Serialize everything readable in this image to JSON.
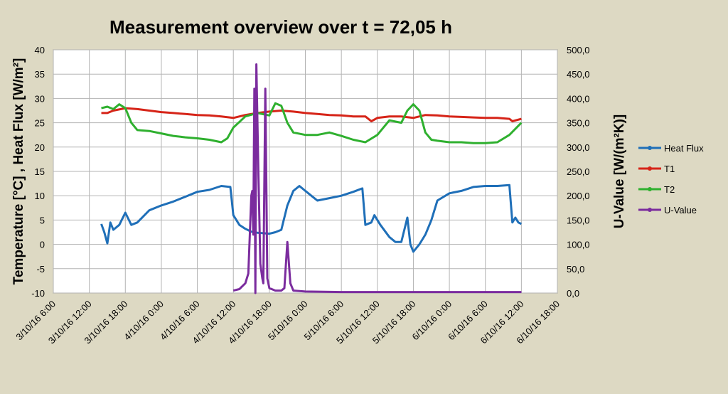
{
  "chart_data": {
    "type": "line",
    "title": "Measurement overview over t = 72,05 h",
    "ylabel": "Temperature [°C] , Heat Flux [W/m²]",
    "y2label": "U-Value [W/(m²K)]",
    "xlabel": "",
    "ylim": [
      -10,
      40
    ],
    "y2lim": [
      0,
      500
    ],
    "xlim": [
      "2016-10-03T06:00",
      "2016-10-06T18:00"
    ],
    "x_ticks": [
      "3/10/16 6:00",
      "3/10/16 12:00",
      "3/10/16 18:00",
      "4/10/16 0:00",
      "4/10/16 6:00",
      "4/10/16 12:00",
      "4/10/16 18:00",
      "5/10/16 0:00",
      "5/10/16 6:00",
      "5/10/16 12:00",
      "5/10/16 18:00",
      "6/10/16 0:00",
      "6/10/16 6:00",
      "6/10/16 12:00",
      "6/10/16 18:00"
    ],
    "y_ticks": [
      "40",
      "35",
      "30",
      "25",
      "20",
      "15",
      "10",
      "5",
      "0",
      "-5",
      "-10"
    ],
    "y2_ticks": [
      "500,0",
      "450,0",
      "400,0",
      "350,0",
      "300,0",
      "250,0",
      "200,0",
      "150,0",
      "100,0",
      "50,0",
      "0,0"
    ],
    "grid": true,
    "legend_position": "right",
    "series": [
      {
        "name": "Heat Flux",
        "axis": "left",
        "color": "#1f6fb8",
        "points": [
          [
            "2016-10-03T14:00",
            4.2
          ],
          [
            "2016-10-03T14:30",
            2.5
          ],
          [
            "2016-10-03T15:00",
            0.2
          ],
          [
            "2016-10-03T15:30",
            4.5
          ],
          [
            "2016-10-03T16:00",
            3.0
          ],
          [
            "2016-10-03T17:00",
            4.0
          ],
          [
            "2016-10-03T18:00",
            6.5
          ],
          [
            "2016-10-03T19:00",
            4.0
          ],
          [
            "2016-10-03T20:00",
            4.5
          ],
          [
            "2016-10-03T22:00",
            7.0
          ],
          [
            "2016-10-04T00:00",
            8.0
          ],
          [
            "2016-10-04T02:00",
            8.8
          ],
          [
            "2016-10-04T04:00",
            9.8
          ],
          [
            "2016-10-04T06:00",
            10.8
          ],
          [
            "2016-10-04T08:00",
            11.2
          ],
          [
            "2016-10-04T10:00",
            12.0
          ],
          [
            "2016-10-04T11:30",
            11.8
          ],
          [
            "2016-10-04T12:00",
            6.0
          ],
          [
            "2016-10-04T13:00",
            4.0
          ],
          [
            "2016-10-04T14:00",
            3.2
          ],
          [
            "2016-10-04T15:00",
            2.6
          ],
          [
            "2016-10-04T16:00",
            2.4
          ],
          [
            "2016-10-04T17:00",
            2.3
          ],
          [
            "2016-10-04T18:00",
            2.2
          ],
          [
            "2016-10-04T19:00",
            2.5
          ],
          [
            "2016-10-04T20:00",
            3.0
          ],
          [
            "2016-10-04T21:00",
            8.0
          ],
          [
            "2016-10-04T22:00",
            11.0
          ],
          [
            "2016-10-04T23:00",
            12.0
          ],
          [
            "2016-10-05T00:00",
            11.0
          ],
          [
            "2016-10-05T01:00",
            10.0
          ],
          [
            "2016-10-05T02:00",
            9.0
          ],
          [
            "2016-10-05T04:00",
            9.5
          ],
          [
            "2016-10-05T06:00",
            10.0
          ],
          [
            "2016-10-05T08:00",
            10.8
          ],
          [
            "2016-10-05T09:30",
            11.5
          ],
          [
            "2016-10-05T10:00",
            4.0
          ],
          [
            "2016-10-05T11:00",
            4.5
          ],
          [
            "2016-10-05T11:30",
            6.0
          ],
          [
            "2016-10-05T12:30",
            4.0
          ],
          [
            "2016-10-05T14:00",
            1.5
          ],
          [
            "2016-10-05T15:00",
            0.5
          ],
          [
            "2016-10-05T16:00",
            0.5
          ],
          [
            "2016-10-05T17:00",
            5.5
          ],
          [
            "2016-10-05T17:30",
            0.0
          ],
          [
            "2016-10-05T18:00",
            -1.5
          ],
          [
            "2016-10-05T19:00",
            0.0
          ],
          [
            "2016-10-05T20:00",
            2.0
          ],
          [
            "2016-10-05T21:00",
            5.0
          ],
          [
            "2016-10-05T22:00",
            9.0
          ],
          [
            "2016-10-06T00:00",
            10.5
          ],
          [
            "2016-10-06T02:00",
            11.0
          ],
          [
            "2016-10-06T04:00",
            11.8
          ],
          [
            "2016-10-06T06:00",
            12.0
          ],
          [
            "2016-10-06T08:00",
            12.0
          ],
          [
            "2016-10-06T10:00",
            12.2
          ],
          [
            "2016-10-06T10:30",
            4.5
          ],
          [
            "2016-10-06T11:00",
            5.5
          ],
          [
            "2016-10-06T11:30",
            4.5
          ],
          [
            "2016-10-06T12:00",
            4.2
          ]
        ]
      },
      {
        "name": "T1",
        "axis": "left",
        "color": "#d62418",
        "points": [
          [
            "2016-10-03T14:00",
            27.0
          ],
          [
            "2016-10-03T15:00",
            27.0
          ],
          [
            "2016-10-03T16:00",
            27.5
          ],
          [
            "2016-10-03T18:00",
            28.0
          ],
          [
            "2016-10-03T20:00",
            27.8
          ],
          [
            "2016-10-03T22:00",
            27.5
          ],
          [
            "2016-10-04T00:00",
            27.2
          ],
          [
            "2016-10-04T02:00",
            27.0
          ],
          [
            "2016-10-04T04:00",
            26.8
          ],
          [
            "2016-10-04T06:00",
            26.6
          ],
          [
            "2016-10-04T08:00",
            26.5
          ],
          [
            "2016-10-04T10:00",
            26.3
          ],
          [
            "2016-10-04T12:00",
            26.0
          ],
          [
            "2016-10-04T14:00",
            26.6
          ],
          [
            "2016-10-04T16:00",
            27.0
          ],
          [
            "2016-10-04T18:00",
            27.3
          ],
          [
            "2016-10-04T20:00",
            27.5
          ],
          [
            "2016-10-04T22:00",
            27.3
          ],
          [
            "2016-10-05T00:00",
            27.0
          ],
          [
            "2016-10-05T02:00",
            26.8
          ],
          [
            "2016-10-05T04:00",
            26.6
          ],
          [
            "2016-10-05T06:00",
            26.5
          ],
          [
            "2016-10-05T08:00",
            26.3
          ],
          [
            "2016-10-05T10:00",
            26.3
          ],
          [
            "2016-10-05T11:00",
            25.3
          ],
          [
            "2016-10-05T12:00",
            26.0
          ],
          [
            "2016-10-05T14:00",
            26.3
          ],
          [
            "2016-10-05T16:00",
            26.3
          ],
          [
            "2016-10-05T18:00",
            26.0
          ],
          [
            "2016-10-05T20:00",
            26.6
          ],
          [
            "2016-10-05T22:00",
            26.5
          ],
          [
            "2016-10-06T00:00",
            26.3
          ],
          [
            "2016-10-06T02:00",
            26.2
          ],
          [
            "2016-10-06T04:00",
            26.1
          ],
          [
            "2016-10-06T06:00",
            26.0
          ],
          [
            "2016-10-06T08:00",
            26.0
          ],
          [
            "2016-10-06T10:00",
            25.8
          ],
          [
            "2016-10-06T10:30",
            25.3
          ],
          [
            "2016-10-06T12:00",
            25.8
          ]
        ]
      },
      {
        "name": "T2",
        "axis": "left",
        "color": "#2fb02f",
        "points": [
          [
            "2016-10-03T14:00",
            28.0
          ],
          [
            "2016-10-03T15:00",
            28.3
          ],
          [
            "2016-10-03T16:00",
            27.8
          ],
          [
            "2016-10-03T17:00",
            28.8
          ],
          [
            "2016-10-03T18:00",
            28.0
          ],
          [
            "2016-10-03T19:00",
            25.0
          ],
          [
            "2016-10-03T20:00",
            23.5
          ],
          [
            "2016-10-03T22:00",
            23.3
          ],
          [
            "2016-10-04T00:00",
            22.8
          ],
          [
            "2016-10-04T02:00",
            22.3
          ],
          [
            "2016-10-04T04:00",
            22.0
          ],
          [
            "2016-10-04T06:00",
            21.8
          ],
          [
            "2016-10-04T08:00",
            21.5
          ],
          [
            "2016-10-04T10:00",
            21.0
          ],
          [
            "2016-10-04T11:00",
            21.8
          ],
          [
            "2016-10-04T12:00",
            24.0
          ],
          [
            "2016-10-04T14:00",
            26.3
          ],
          [
            "2016-10-04T16:00",
            27.0
          ],
          [
            "2016-10-04T18:00",
            26.5
          ],
          [
            "2016-10-04T19:00",
            29.0
          ],
          [
            "2016-10-04T20:00",
            28.5
          ],
          [
            "2016-10-04T21:00",
            25.0
          ],
          [
            "2016-10-04T22:00",
            23.0
          ],
          [
            "2016-10-05T00:00",
            22.5
          ],
          [
            "2016-10-05T02:00",
            22.5
          ],
          [
            "2016-10-05T04:00",
            23.0
          ],
          [
            "2016-10-05T06:00",
            22.3
          ],
          [
            "2016-10-05T08:00",
            21.5
          ],
          [
            "2016-10-05T10:00",
            21.0
          ],
          [
            "2016-10-05T12:00",
            22.5
          ],
          [
            "2016-10-05T14:00",
            25.5
          ],
          [
            "2016-10-05T16:00",
            25.0
          ],
          [
            "2016-10-05T17:00",
            27.5
          ],
          [
            "2016-10-05T18:00",
            28.8
          ],
          [
            "2016-10-05T19:00",
            27.5
          ],
          [
            "2016-10-05T20:00",
            23.0
          ],
          [
            "2016-10-05T21:00",
            21.5
          ],
          [
            "2016-10-05T22:00",
            21.3
          ],
          [
            "2016-10-06T00:00",
            21.0
          ],
          [
            "2016-10-06T02:00",
            21.0
          ],
          [
            "2016-10-06T04:00",
            20.8
          ],
          [
            "2016-10-06T06:00",
            20.8
          ],
          [
            "2016-10-06T08:00",
            21.0
          ],
          [
            "2016-10-06T10:00",
            22.5
          ],
          [
            "2016-10-06T12:00",
            25.0
          ]
        ]
      },
      {
        "name": "U-Value",
        "axis": "right",
        "color": "#7b2c9e",
        "points": [
          [
            "2016-10-04T12:00",
            5
          ],
          [
            "2016-10-04T13:00",
            8
          ],
          [
            "2016-10-04T14:00",
            20
          ],
          [
            "2016-10-04T14:30",
            40
          ],
          [
            "2016-10-04T15:00",
            200
          ],
          [
            "2016-10-04T15:10",
            210
          ],
          [
            "2016-10-04T15:20",
            120
          ],
          [
            "2016-10-04T15:30",
            420
          ],
          [
            "2016-10-04T15:40",
            0
          ],
          [
            "2016-10-04T15:50",
            470
          ],
          [
            "2016-10-04T16:10",
            250
          ],
          [
            "2016-10-04T16:30",
            60
          ],
          [
            "2016-10-04T16:50",
            30
          ],
          [
            "2016-10-04T17:00",
            20
          ],
          [
            "2016-10-04T17:20",
            420
          ],
          [
            "2016-10-04T17:40",
            30
          ],
          [
            "2016-10-04T18:00",
            10
          ],
          [
            "2016-10-04T19:00",
            5
          ],
          [
            "2016-10-04T20:00",
            5
          ],
          [
            "2016-10-04T20:30",
            10
          ],
          [
            "2016-10-04T21:00",
            105
          ],
          [
            "2016-10-04T21:30",
            20
          ],
          [
            "2016-10-04T22:00",
            5
          ],
          [
            "2016-10-05T00:00",
            3
          ],
          [
            "2016-10-05T06:00",
            2
          ],
          [
            "2016-10-05T12:00",
            2
          ],
          [
            "2016-10-06T00:00",
            2
          ],
          [
            "2016-10-06T12:00",
            2
          ]
        ]
      }
    ]
  }
}
